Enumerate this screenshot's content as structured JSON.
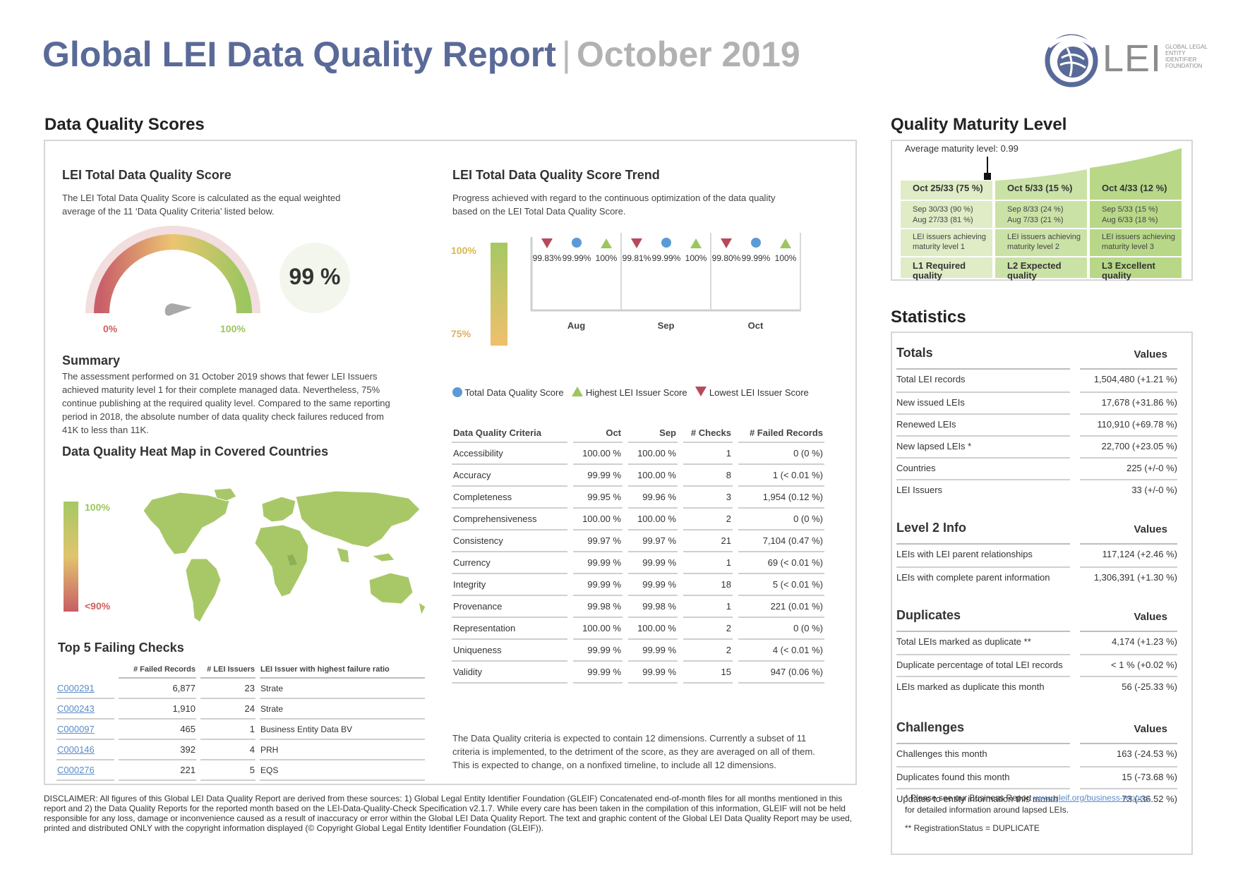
{
  "header": {
    "title": "Global LEI Data Quality Report",
    "separator": "|",
    "subtitle": "October 2019",
    "logo_text": "LEI",
    "logo_small": "GLOBAL LEGAL ENTITY IDENTIFIER FOUNDATION"
  },
  "dq_scores": {
    "section_title": "Data Quality Scores",
    "total_score": {
      "title": "LEI Total Data Quality Score",
      "description": "The LEI Total Data Quality Score is calculated as the equal weighted average of the 11 ‘Data Quality Criteria’ listed below.",
      "gauge_min": "0%",
      "gauge_max": "100%",
      "value_label": "99 %",
      "value": 99
    },
    "summary": {
      "title": "Summary",
      "text": "The assessment performed on 31 October 2019 shows that fewer LEI Issuers achieved maturity level 1 for their complete managed data. Nevertheless, 75% continue publishing at the required quality level. Compared to the same reporting period in 2018, the absolute number of data quality check failures reduced from 41K to less than 11K."
    },
    "heatmap": {
      "title": "Data Quality Heat Map in Covered Countries",
      "legend_top": "100%",
      "legend_bottom": "<90%"
    },
    "top5": {
      "title": "Top 5 Failing Checks",
      "columns": [
        "# Failed Records",
        "# LEI Issuers",
        "LEI Issuer with highest failure ratio"
      ],
      "rows": [
        {
          "id": "C000291",
          "failed": "6,877",
          "issuers": "23",
          "issuer": "Strate"
        },
        {
          "id": "C000243",
          "failed": "1,910",
          "issuers": "24",
          "issuer": "Strate"
        },
        {
          "id": "C000097",
          "failed": "465",
          "issuers": "1",
          "issuer": "Business Entity Data BV"
        },
        {
          "id": "C000146",
          "failed": "392",
          "issuers": "4",
          "issuer": "PRH"
        },
        {
          "id": "C000276",
          "failed": "221",
          "issuers": "5",
          "issuer": "EQS"
        }
      ]
    },
    "trend": {
      "title": "LEI Total Data Quality Score Trend",
      "description": "Progress achieved with regard to the continuous optimization of the data quality based on the LEI Total Data Quality Score.",
      "axis_top": "100%",
      "axis_bottom": "75%",
      "legend": {
        "total": "Total Data Quality Score",
        "highest": "Highest LEI Issuer Score",
        "lowest": "Lowest LEI Issuer Score"
      }
    },
    "criteria": {
      "title": "Data Quality Criteria",
      "columns": [
        "Oct",
        "Sep",
        "# Checks",
        "# Failed Records"
      ],
      "rows": [
        {
          "name": "Accessibility",
          "oct": "100.00 %",
          "sep": "100.00 %",
          "checks": "1",
          "failed": "0 (0 %)"
        },
        {
          "name": "Accuracy",
          "oct": "99.99 %",
          "sep": "100.00 %",
          "checks": "8",
          "failed": "1 (< 0.01 %)"
        },
        {
          "name": "Completeness",
          "oct": "99.95 %",
          "sep": "99.96 %",
          "checks": "3",
          "failed": "1,954 (0.12 %)"
        },
        {
          "name": "Comprehensiveness",
          "oct": "100.00 %",
          "sep": "100.00 %",
          "checks": "2",
          "failed": "0 (0 %)"
        },
        {
          "name": "Consistency",
          "oct": "99.97 %",
          "sep": "99.97 %",
          "checks": "21",
          "failed": "7,104 (0.47 %)"
        },
        {
          "name": "Currency",
          "oct": "99.99 %",
          "sep": "99.99 %",
          "checks": "1",
          "failed": "69 (< 0.01 %)"
        },
        {
          "name": "Integrity",
          "oct": "99.99 %",
          "sep": "99.99 %",
          "checks": "18",
          "failed": "5 (< 0.01 %)"
        },
        {
          "name": "Provenance",
          "oct": "99.98 %",
          "sep": "99.98 %",
          "checks": "1",
          "failed": "221 (0.01 %)"
        },
        {
          "name": "Representation",
          "oct": "100.00 %",
          "sep": "100.00 %",
          "checks": "2",
          "failed": "0 (0 %)"
        },
        {
          "name": "Uniqueness",
          "oct": "99.99 %",
          "sep": "99.99 %",
          "checks": "2",
          "failed": "4 (< 0.01 %)"
        },
        {
          "name": "Validity",
          "oct": "99.99 %",
          "sep": "99.99 %",
          "checks": "15",
          "failed": "947 (0.06 %)"
        }
      ],
      "note": "The Data Quality criteria is expected to contain 12 dimensions. Currently a subset of 11 criteria is implemented, to the detriment of the score, as they are averaged on all of them. This is expected to change, on a nonfixed timeline, to include all 12 dimensions."
    }
  },
  "chart_data": {
    "type": "scatter",
    "categories": [
      "Aug",
      "Sep",
      "Oct"
    ],
    "series": [
      {
        "name": "Lowest LEI Issuer Score",
        "values": [
          99.83,
          99.81,
          99.8
        ],
        "labels": [
          "99.83%",
          "99.81%",
          "99.80%"
        ]
      },
      {
        "name": "Total Data Quality Score",
        "values": [
          99.99,
          99.99,
          99.99
        ],
        "labels": [
          "99.99%",
          "99.99%",
          "99.99%"
        ]
      },
      {
        "name": "Highest LEI Issuer Score",
        "values": [
          100,
          100,
          100
        ],
        "labels": [
          "100%",
          "100%",
          "100%"
        ]
      }
    ],
    "ylim": [
      75,
      100
    ]
  },
  "maturity": {
    "title": "Quality Maturity Level",
    "average": "Average maturity level: 0.99",
    "average_value": 0.99,
    "columns": [
      {
        "head": "Oct 25/33 (75 %)",
        "hist1": "Sep 30/33 (90 %)",
        "hist2": "Aug 27/33 (81 %)",
        "desc": "LEI issuers achieving maturity level 1",
        "foot": "L1 Required quality"
      },
      {
        "head": "Oct 5/33 (15 %)",
        "hist1": "Sep 8/33 (24 %)",
        "hist2": "Aug 7/33 (21 %)",
        "desc": "LEI issuers achieving maturity level 2",
        "foot": "L2 Expected quality"
      },
      {
        "head": "Oct 4/33 (12 %)",
        "hist1": "Sep 5/33 (15 %)",
        "hist2": "Aug 6/33 (18 %)",
        "desc": "LEI issuers achieving maturity level 3",
        "foot": "L3 Excellent quality"
      }
    ],
    "colors": {
      "l1": "#dfecc6",
      "l2": "#cbe2a7",
      "l3": "#b8d888"
    }
  },
  "statistics": {
    "title": "Statistics",
    "values_label": "Values",
    "groups": [
      {
        "title": "Totals",
        "rows": [
          {
            "k": "Total LEI records",
            "v": "1,504,480 (+1.21 %)"
          },
          {
            "k": "New issued LEIs",
            "v": "17,678 (+31.86 %)"
          },
          {
            "k": "Renewed LEIs",
            "v": "110,910 (+69.78 %)"
          },
          {
            "k": "New lapsed LEIs *",
            "v": "22,700 (+23.05 %)"
          },
          {
            "k": "Countries",
            "v": "225 (+/-0 %)"
          },
          {
            "k": "LEI Issuers",
            "v": "33 (+/-0 %)"
          }
        ]
      },
      {
        "title": "Level 2 Info",
        "rows": [
          {
            "k": "LEIs with LEI parent relationships",
            "v": "117,124 (+2.46 %)"
          },
          {
            "k": "LEIs with complete parent information",
            "v": "1,306,391 (+1.30 %)"
          }
        ]
      },
      {
        "title": "Duplicates",
        "rows": [
          {
            "k": "Total LEIs marked as duplicate **",
            "v": "4,174 (+1.23 %)"
          },
          {
            "k": "Duplicate percentage of total LEI records",
            "v": "< 1 % (+0.02 %)"
          },
          {
            "k": "LEIs marked as duplicate this month",
            "v": "56 (-25.33 %)"
          }
        ]
      },
      {
        "title": "Challenges",
        "rows": [
          {
            "k": "Challenges this month",
            "v": "163 (-24.53 %)"
          },
          {
            "k": "Duplicates found this month",
            "v": "15 (-73.68 %)"
          },
          {
            "k": "Updates to entity information this month",
            "v": "73 (-36.52 %)"
          }
        ]
      }
    ],
    "footnote1_prefix": "* Please see our Business Report ",
    "footnote1_link": "www.gleif.org/business-reports",
    "footnote1_suffix": "for detailed information around lapsed LEIs.",
    "footnote2": "** RegistrationStatus = DUPLICATE"
  },
  "disclaimer": "DISCLAIMER: All figures of this Global LEI Data Quality Report are derived from these sources: 1) Global Legal Entity Identifier Foundation (GLEIF) Concatenated end-of-month files for all months mentioned in this report and 2) the Data Quality Reports for the reported month based on the LEI-Data-Quality-Check Specification v2.1.7. While every care has been taken in the compilation of this information, GLEIF will not be held responsible for any loss, damage or inconvenience caused as a result of inaccuracy or error within the Global LEI Data Quality Report. The text and graphic content of the Global LEI Data Quality Report may be used, printed and distributed ONLY with the copyright information displayed (© Copyright Global Legal Entity Identifier Foundation (GLEIF))."
}
